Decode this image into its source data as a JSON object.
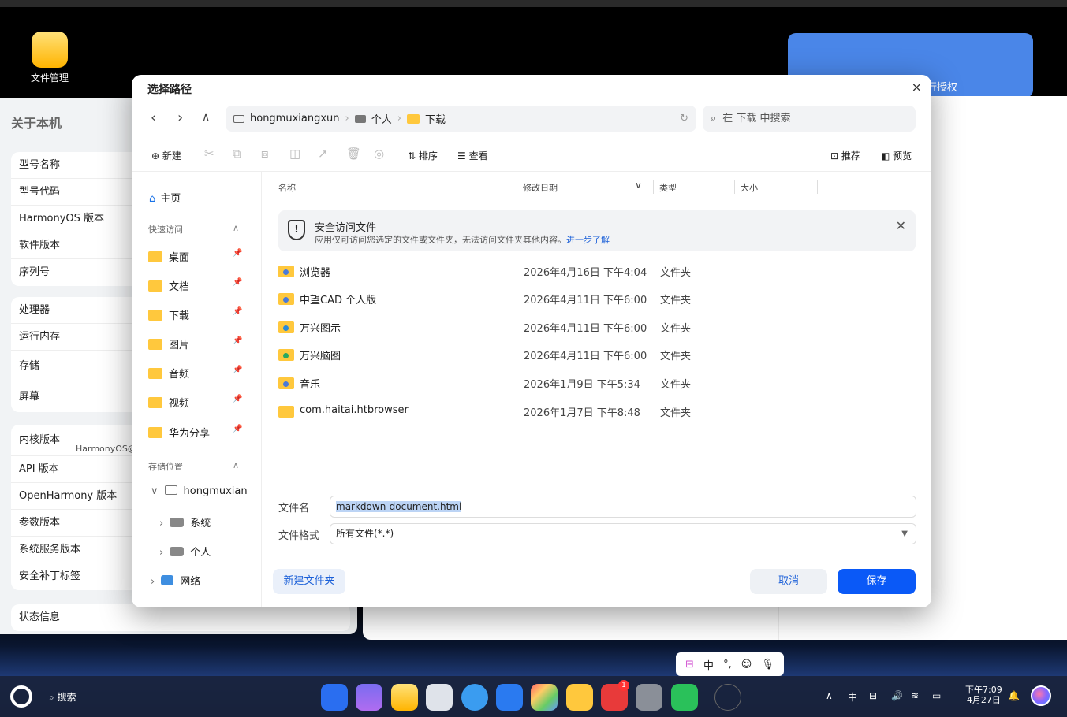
{
  "desktop": {
    "icon_label": "文件管理"
  },
  "bg_left": {
    "title": "关于本机",
    "group1": [
      "型号名称",
      "型号代码",
      "HarmonyOS 版本",
      "软件版本",
      "序列号"
    ],
    "group2": [
      "处理器",
      "运行内存",
      "存储",
      "屏幕"
    ],
    "group3": [
      "内核版本",
      "API 版本",
      "OpenHarmony 版本",
      "参数版本",
      "系统服务版本",
      "安全补丁标签"
    ],
    "kernel_value": "HarmonyOS@",
    "status": "状态信息"
  },
  "bg_right": {
    "card_label": "行授权"
  },
  "dialog": {
    "title": "选择路径",
    "path": {
      "device": "hongmuxiangxun",
      "folder1": "个人",
      "folder2": "下载"
    },
    "search_placeholder": "在 下载 中搜索",
    "toolbar": {
      "new": "新建",
      "sort": "排序",
      "view": "查看",
      "recommend": "推荐",
      "preview": "预览"
    },
    "nav": {
      "home": "主页",
      "quick_access": "快速访问",
      "quick_items": [
        "桌面",
        "文档",
        "下载",
        "图片",
        "音频",
        "视频",
        "华为分享"
      ],
      "storage": "存储位置",
      "device": "hongmuxian",
      "system": "系统",
      "personal": "个人",
      "network": "网络"
    },
    "columns": {
      "name": "名称",
      "date": "修改日期",
      "type": "类型",
      "size": "大小"
    },
    "notice": {
      "title": "安全访问文件",
      "text": "应用仅可访问您选定的文件或文件夹，无法访问文件夹其他内容。",
      "link": "进一步了解"
    },
    "files": [
      {
        "name": "浏览器",
        "date": "2026年4月16日 下午4:04",
        "type": "文件夹"
      },
      {
        "name": "中望CAD 个人版",
        "date": "2026年4月11日 下午6:00",
        "type": "文件夹"
      },
      {
        "name": "万兴图示",
        "date": "2026年4月11日 下午6:00",
        "type": "文件夹"
      },
      {
        "name": "万兴脑图",
        "date": "2026年4月11日 下午6:00",
        "type": "文件夹"
      },
      {
        "name": "音乐",
        "date": "2026年1月9日 下午5:34",
        "type": "文件夹"
      },
      {
        "name": "com.haitai.htbrowser",
        "date": "2026年1月7日 下午8:48",
        "type": "文件夹"
      }
    ],
    "filename_label": "文件名",
    "filename_value": "markdown-document.html",
    "format_label": "文件格式",
    "format_value": "所有文件(*.*)",
    "new_folder": "新建文件夹",
    "cancel": "取消",
    "save": "保存"
  },
  "ime": {
    "lang": "中",
    "punct": "°,"
  },
  "taskbar": {
    "search": "搜索",
    "badge": "1",
    "time": "下午7:09",
    "date": "4月27日",
    "tray_lang": "中"
  },
  "colors": {
    "accent": "#0a59f7",
    "folder": "#ffc83d"
  }
}
